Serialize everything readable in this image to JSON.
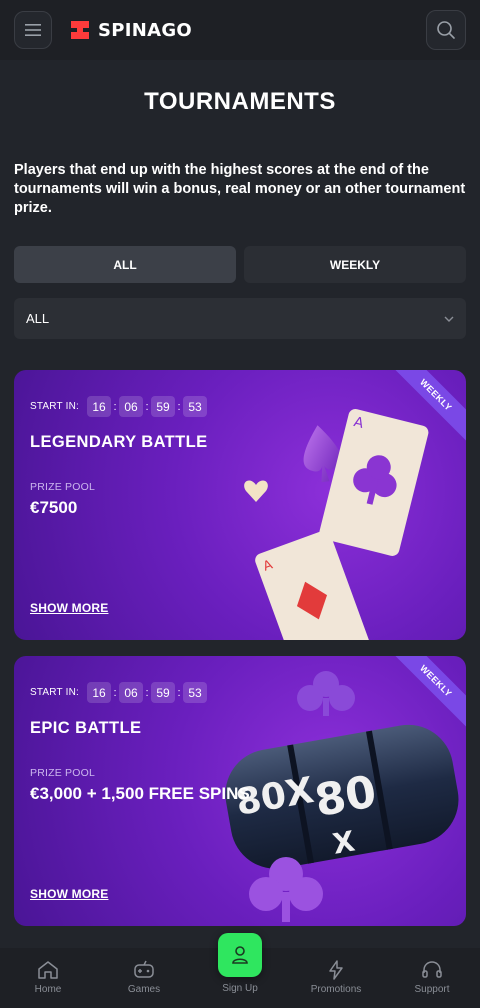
{
  "header": {
    "menu_icon": "hamburger-icon",
    "logo_text": "SPINAGO",
    "search_icon": "search-icon",
    "brand_color": "#ff3b3b"
  },
  "page": {
    "title": "TOURNAMENTS",
    "intro": "Players that end up with the highest scores at the end of the tournaments will win a bonus, real money or an other tournament prize."
  },
  "tabs": [
    {
      "label": "ALL",
      "active": true
    },
    {
      "label": "WEEKLY",
      "active": false
    }
  ],
  "filter": {
    "selected": "ALL",
    "icon": "chevron-down-icon"
  },
  "tournaments": [
    {
      "ribbon": "WEEKLY",
      "start_label": "START IN:",
      "timer": [
        "16",
        "06",
        "59",
        "53"
      ],
      "title": "LEGENDARY BATTLE",
      "prize_label": "PRIZE POOL",
      "prize_value": "€7500",
      "show_more": "SHOW MORE"
    },
    {
      "ribbon": "WEEKLY",
      "start_label": "START IN:",
      "timer": [
        "16",
        "06",
        "59",
        "53"
      ],
      "title": "EPIC BATTLE",
      "prize_label": "PRIZE POOL",
      "prize_value": "€3,000 + 1,500 FREE SPINS",
      "show_more": "SHOW MORE",
      "art_text": "80X"
    }
  ],
  "bottom_nav": [
    {
      "label": "Home",
      "icon": "home-icon"
    },
    {
      "label": "Games",
      "icon": "gamepad-icon"
    },
    {
      "label": "Sign Up",
      "icon": "user-icon",
      "accent": "#2fe65f"
    },
    {
      "label": "Promotions",
      "icon": "lightning-icon"
    },
    {
      "label": "Support",
      "icon": "headset-icon"
    }
  ]
}
